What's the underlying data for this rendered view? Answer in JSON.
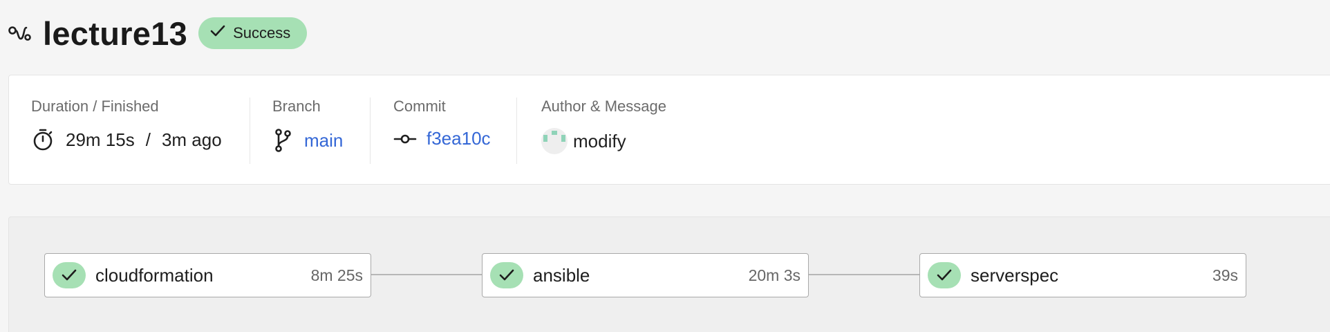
{
  "header": {
    "title": "lecture13",
    "status_label": "Success",
    "status_color": "#a6e0b4"
  },
  "info": {
    "duration_label": "Duration / Finished",
    "duration": "29m 15s",
    "separator": "/",
    "finished": "3m ago",
    "branch_label": "Branch",
    "branch": "main",
    "commit_label": "Commit",
    "commit": "f3ea10c",
    "author_label": "Author & Message",
    "message": "modify",
    "link_color": "#3467d6"
  },
  "pipeline": {
    "jobs": [
      {
        "name": "cloudformation",
        "duration": "8m 25s",
        "status": "success"
      },
      {
        "name": "ansible",
        "duration": "20m 3s",
        "status": "success"
      },
      {
        "name": "serverspec",
        "duration": "39s",
        "status": "success"
      }
    ]
  },
  "icons": {
    "workflow": "workflow-icon",
    "check": "check-icon",
    "stopwatch": "stopwatch-icon",
    "branch": "git-branch-icon",
    "commit": "git-commit-icon",
    "avatar": "avatar-identicon"
  }
}
